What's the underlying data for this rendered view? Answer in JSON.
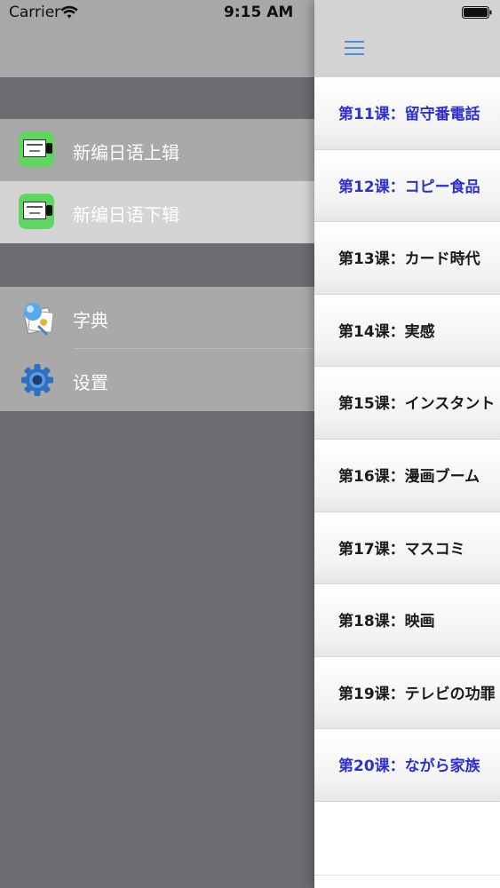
{
  "status_bar": {
    "carrier": "Carrier",
    "time": "9:15 AM"
  },
  "drawer": {
    "books": [
      {
        "label": "新编日语上辑",
        "icon": "book-icon"
      },
      {
        "label": "新编日语下辑",
        "icon": "book-icon",
        "selected": true
      }
    ],
    "tools": [
      {
        "label": "字典",
        "icon": "dictionary-icon"
      },
      {
        "label": "设置",
        "icon": "gear-icon"
      }
    ]
  },
  "lessons": [
    {
      "label": "第11课：留守番電話",
      "read": true
    },
    {
      "label": "第12课：コピー食品",
      "read": true
    },
    {
      "label": "第13课：カード時代",
      "read": false
    },
    {
      "label": "第14课：実感",
      "read": false
    },
    {
      "label": "第15课：インスタント",
      "read": false
    },
    {
      "label": "第16课：漫画ブーム",
      "read": false
    },
    {
      "label": "第17课：マスコミ",
      "read": false
    },
    {
      "label": "第18课：映画",
      "read": false
    },
    {
      "label": "第19课：テレビの功罪",
      "read": false
    },
    {
      "label": "第20课：ながら家族",
      "read": true
    }
  ],
  "colors": {
    "read_lesson": "#2e2ed1",
    "unread_lesson": "#1a1a1a",
    "accent": "#4a90d9",
    "book_icon": "#5fd65f"
  }
}
